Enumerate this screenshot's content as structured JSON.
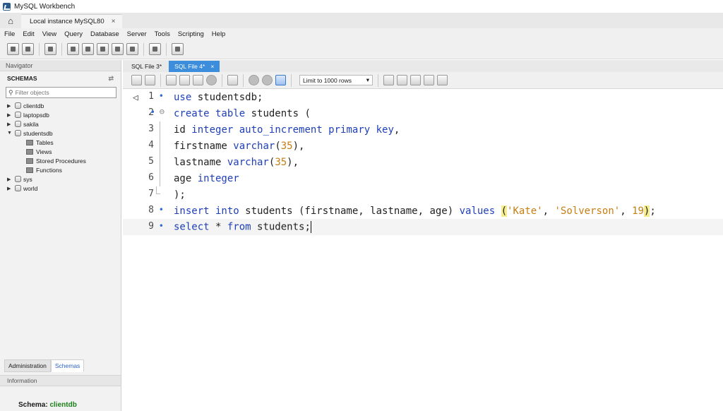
{
  "window": {
    "title": "MySQL Workbench"
  },
  "connection_tab": {
    "label": "Local instance MySQL80",
    "close": "×"
  },
  "menu": [
    "File",
    "Edit",
    "View",
    "Query",
    "Database",
    "Server",
    "Tools",
    "Scripting",
    "Help"
  ],
  "navigator": {
    "header": "Navigator",
    "schemas_label": "SCHEMAS",
    "filter_placeholder": "Filter objects",
    "schemas": [
      {
        "name": "clientdb",
        "expanded": false
      },
      {
        "name": "laptopsdb",
        "expanded": false
      },
      {
        "name": "sakila",
        "expanded": false
      },
      {
        "name": "studentsdb",
        "expanded": true,
        "children": [
          "Tables",
          "Views",
          "Stored Procedures",
          "Functions"
        ]
      },
      {
        "name": "sys",
        "expanded": false
      },
      {
        "name": "world",
        "expanded": false
      }
    ],
    "tabs": [
      "Administration",
      "Schemas"
    ],
    "active_tab": "Schemas",
    "info_header": "Information",
    "schema_info_label": "Schema:",
    "schema_info_value": "clientdb"
  },
  "editor_tabs": [
    {
      "label": "SQL File 3*",
      "active": false
    },
    {
      "label": "SQL File 4*",
      "active": true,
      "close": "×"
    }
  ],
  "editor_toolbar": {
    "limit_label": "Limit to 1000 rows"
  },
  "editor": {
    "lines": [
      {
        "n": "1",
        "text": "use studentsdb;"
      },
      {
        "n": "2",
        "text": "create table students ("
      },
      {
        "n": "3",
        "text": "id integer auto_increment primary key,"
      },
      {
        "n": "4",
        "text": "firstname varchar(35),"
      },
      {
        "n": "5",
        "text": "lastname varchar(35),"
      },
      {
        "n": "6",
        "text": "age integer"
      },
      {
        "n": "7",
        "text": ");"
      },
      {
        "n": "8",
        "text": "insert into students (firstname, lastname, age) values ('Kate', 'Solverson', 19);"
      },
      {
        "n": "9",
        "text": "select * from students;"
      }
    ]
  },
  "colors": {
    "keyword": "#1f3fb8",
    "string": "#c77d10",
    "active_tab": "#3c8edc",
    "schema_value": "#1b7f1b"
  }
}
